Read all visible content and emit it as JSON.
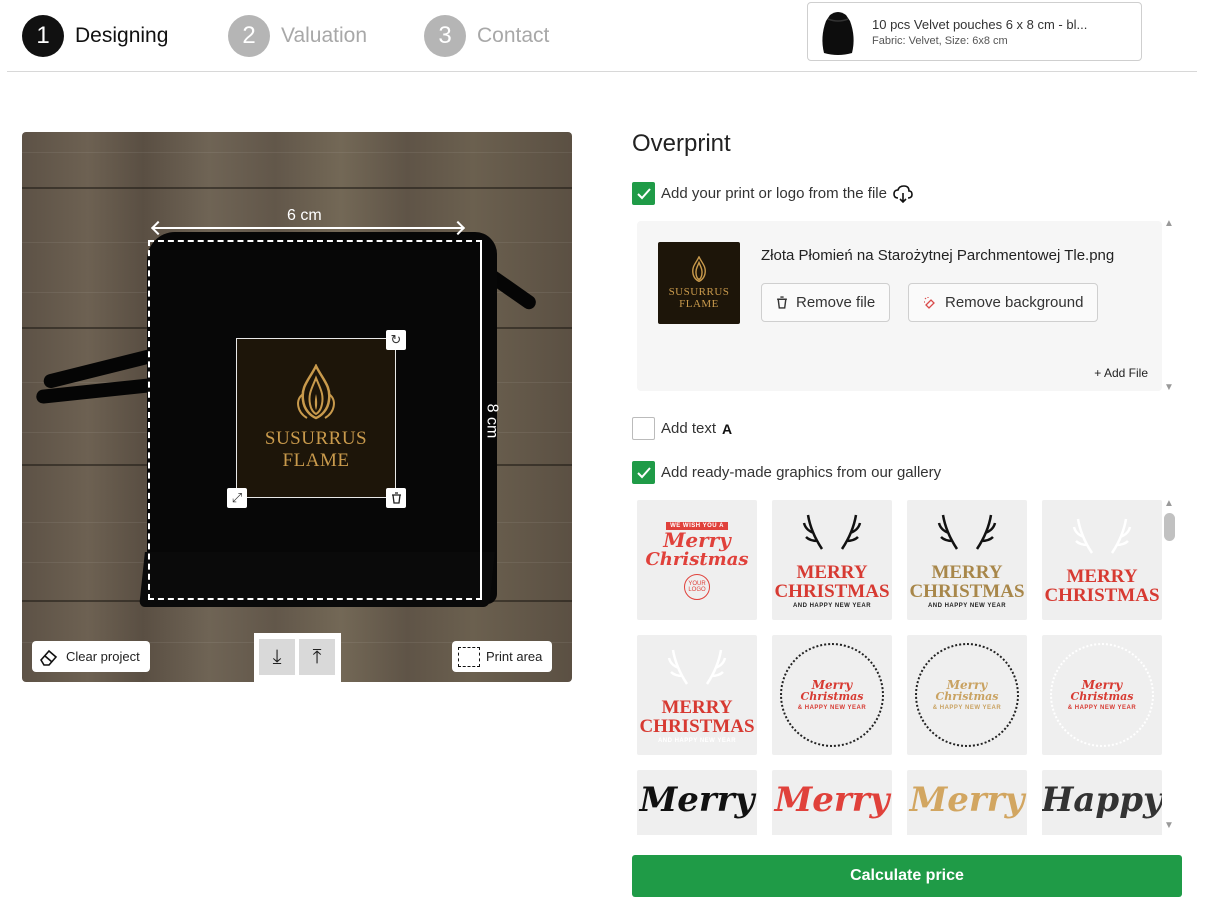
{
  "steps": [
    {
      "number": "1",
      "label": "Designing"
    },
    {
      "number": "2",
      "label": "Valuation"
    },
    {
      "number": "3",
      "label": "Contact"
    }
  ],
  "product": {
    "title": "10 pcs Velvet pouches 6 x 8 cm - bl...",
    "subtitle": "Fabric: Velvet, Size: 6x8 cm"
  },
  "preview": {
    "width_label": "6 cm",
    "height_label": "8 cm",
    "logo_text": [
      "SUSURRUS",
      "FLAME"
    ],
    "clear_label": "Clear project",
    "print_area_label": "Print area"
  },
  "overprint": {
    "title": "Overprint",
    "option_file": "Add your print or logo from the file",
    "option_text": "Add text",
    "option_gallery": "Add ready-made graphics from our gallery",
    "file_name": "Złota Płomień na Starożytnej Parchmentowej Tle.png",
    "remove_file": "Remove file",
    "remove_background": "Remove background",
    "add_file": "+ Add File",
    "thumb_text": [
      "SUSURRUS",
      "FLAME"
    ]
  },
  "gallery": [
    {
      "lines": [
        "WE WISH YOU A",
        "Merry",
        "Christmas",
        "YOUR LOGO"
      ],
      "color": "#e0413b",
      "style": "script"
    },
    {
      "lines": [
        "MERRY",
        "CHRISTMAS",
        "AND HAPPY NEW YEAR"
      ],
      "color": "#d73a32",
      "style": "block"
    },
    {
      "lines": [
        "MERRY",
        "CHRISTMAS",
        "AND HAPPY NEW YEAR"
      ],
      "color": "#a8874a",
      "style": "block"
    },
    {
      "lines": [
        "MERRY",
        "CHRISTMAS"
      ],
      "color": "#d73a32",
      "style": "block"
    },
    {
      "lines": [
        "MERRY",
        "CHRISTMAS",
        "AND HAPPY NEW YEAR"
      ],
      "color": "#d73a32",
      "style": "block"
    },
    {
      "lines": [
        "Merry",
        "Christmas",
        "& HAPPY NEW YEAR"
      ],
      "color": "#d73a32",
      "style": "wreath"
    },
    {
      "lines": [
        "Merry",
        "Christmas",
        "& HAPPY NEW YEAR"
      ],
      "color": "#c9a261",
      "style": "wreath"
    },
    {
      "lines": [
        "Merry",
        "Christmas",
        "& HAPPY NEW YEAR"
      ],
      "color": "#d73a32",
      "style": "wreath"
    },
    {
      "lines": [
        "Merry"
      ],
      "color": "#111111",
      "style": "script"
    },
    {
      "lines": [
        "Merry"
      ],
      "color": "#e0413b",
      "style": "script"
    },
    {
      "lines": [
        "Merry"
      ],
      "color": "#d2a661",
      "style": "script"
    },
    {
      "lines": [
        "Happy"
      ],
      "color": "#333333",
      "style": "script"
    }
  ],
  "calculate_label": "Calculate price",
  "colors": {
    "accent": "#1f9b47",
    "step_active": "#111111",
    "step_inactive": "#b5b5b5"
  }
}
